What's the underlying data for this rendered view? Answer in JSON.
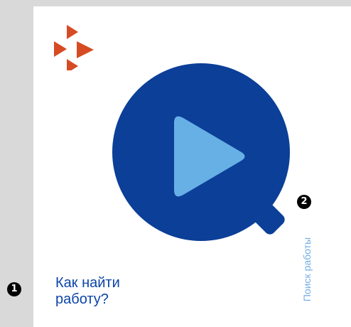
{
  "card": {
    "title": "Как найти\nработу?"
  },
  "side": {
    "vertical_label": "Поиск работы"
  },
  "callouts": {
    "first": "1",
    "second": "2"
  },
  "icons": {
    "logo": "arrow-cluster-logo",
    "video": "play-search-icon"
  },
  "colors": {
    "background": "#d9d9d9",
    "card": "#ffffff",
    "logo_red": "#d64b24",
    "search_blue": "#0b3f98",
    "play_light_blue": "#67b0e6",
    "title_blue": "#0b44a8",
    "side_label_blue": "#73aee3"
  }
}
